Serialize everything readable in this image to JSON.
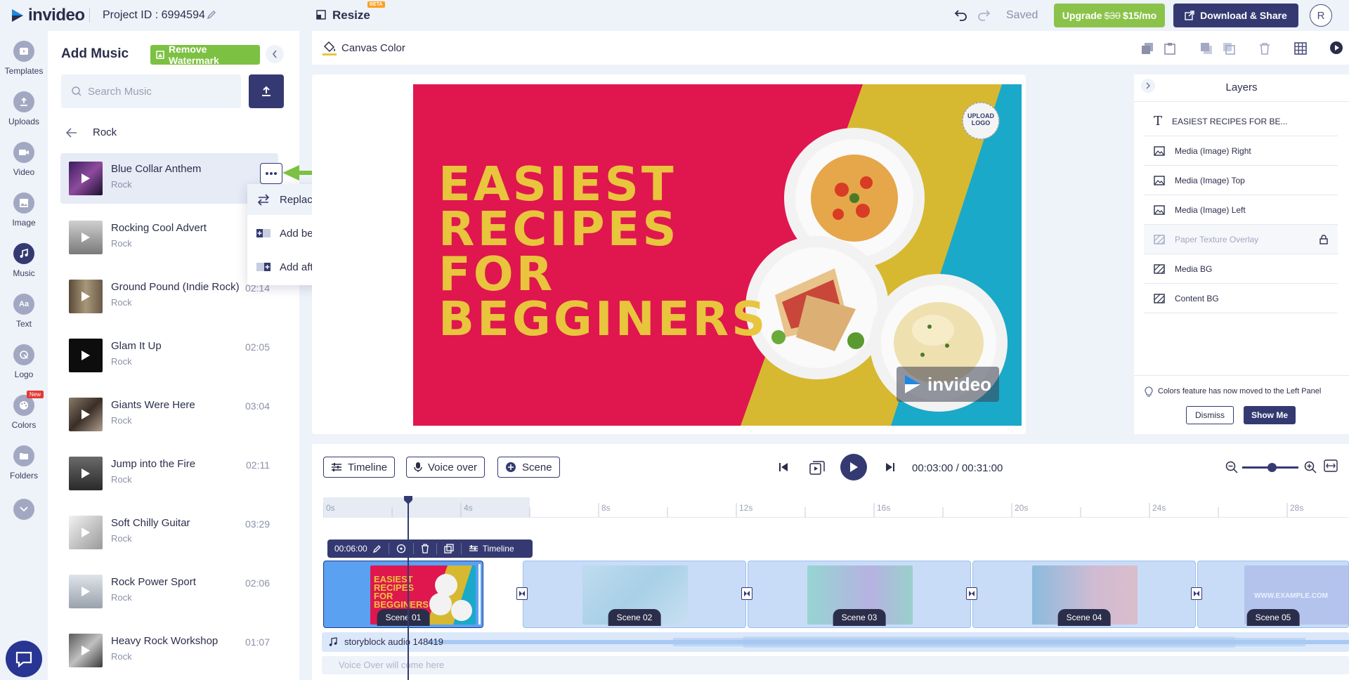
{
  "topbar": {
    "brand": "invideo",
    "project_id": "Project ID : 6994594",
    "resize_label": "Resize",
    "beta_badge": "BETA",
    "saved_status": "Saved",
    "upgrade_label": "Upgrade",
    "upgrade_old_price": "$30",
    "upgrade_new_price": "$15/mo",
    "download_label": "Download & Share",
    "avatar_initial": "R"
  },
  "rail": {
    "items": [
      {
        "label": "Templates",
        "icon": "templates-icon"
      },
      {
        "label": "Uploads",
        "icon": "upload-icon"
      },
      {
        "label": "Video",
        "icon": "video-icon"
      },
      {
        "label": "Image",
        "icon": "image-icon"
      },
      {
        "label": "Music",
        "icon": "music-icon"
      },
      {
        "label": "Text",
        "icon": "text-icon"
      },
      {
        "label": "Logo",
        "icon": "logo-icon"
      },
      {
        "label": "Colors",
        "icon": "palette-icon"
      },
      {
        "label": "Folders",
        "icon": "folder-icon"
      }
    ],
    "new_badge": "New"
  },
  "music_panel": {
    "title": "Add Music",
    "watermark_label": "Remove Watermark",
    "search_placeholder": "Search Music",
    "category": "Rock",
    "tracks": [
      {
        "title": "Blue Collar Anthem",
        "genre": "Rock",
        "duration": ""
      },
      {
        "title": "Rocking Cool Advert",
        "genre": "Rock",
        "duration": ""
      },
      {
        "title": "Ground Pound (Indie Rock)",
        "genre": "Rock",
        "duration": "02:14"
      },
      {
        "title": "Glam It Up",
        "genre": "Rock",
        "duration": "02:05"
      },
      {
        "title": "Giants Were Here",
        "genre": "Rock",
        "duration": "03:04"
      },
      {
        "title": "Jump into the Fire",
        "genre": "Rock",
        "duration": "02:11"
      },
      {
        "title": "Soft Chilly Guitar",
        "genre": "Rock",
        "duration": "03:29"
      },
      {
        "title": "Rock Power Sport",
        "genre": "Rock",
        "duration": "02:06"
      },
      {
        "title": "Heavy Rock Workshop",
        "genre": "Rock",
        "duration": "01:07"
      }
    ],
    "context_menu": [
      "Replace music",
      "Add before track",
      "Add after track"
    ]
  },
  "canvas_bar": {
    "canvas_color_label": "Canvas Color"
  },
  "canvas": {
    "headline": [
      "EASIEST",
      "RECIPES",
      "FOR",
      "BEGGINERS"
    ],
    "upload_logo": [
      "UPLOAD",
      "LOGO"
    ],
    "watermark": "invideo",
    "colors": {
      "pink": "#e0164f",
      "yellow": "#d6b931",
      "teal": "#1aa9c9",
      "headline": "#e8c53c"
    }
  },
  "layers": {
    "title": "Layers",
    "items": [
      {
        "label": "EASIEST RECIPES FOR BE...",
        "icon": "text-icon"
      },
      {
        "label": "Media (Image) Right",
        "icon": "image-icon"
      },
      {
        "label": "Media (Image) Top",
        "icon": "image-icon"
      },
      {
        "label": "Media (Image) Left",
        "icon": "image-icon"
      },
      {
        "label": "Paper Texture Overlay",
        "icon": "texture-icon"
      },
      {
        "label": "Media BG",
        "icon": "texture-icon"
      },
      {
        "label": "Content BG",
        "icon": "texture-icon"
      }
    ],
    "notice": "Colors feature has now moved to the Left Panel",
    "dismiss_label": "Dismiss",
    "show_me_label": "Show Me"
  },
  "timeline": {
    "timeline_label": "Timeline",
    "voiceover_label": "Voice over",
    "scene_label": "Scene",
    "current_time": "00:03:00",
    "separator": "/",
    "total_time": "00:31:00",
    "ruler": [
      "0s",
      "4s",
      "8s",
      "12s",
      "16s",
      "20s",
      "24s",
      "28s"
    ],
    "mini_toolbar_time": "00:06:00",
    "mini_toolbar_timeline": "Timeline",
    "scenes": [
      "Scene 01",
      "Scene 02",
      "Scene 03",
      "Scene 04",
      "Scene 05"
    ],
    "scene1_thumb_text": [
      "EASIEST",
      "RECIPES",
      "FOR",
      "BEGGINERS"
    ],
    "scene5_thumb_text": "WWW.EXAMPLE.COM",
    "audio_track": "storyblock audio 148419",
    "voiceover_placeholder": "Voice Over will come here"
  }
}
